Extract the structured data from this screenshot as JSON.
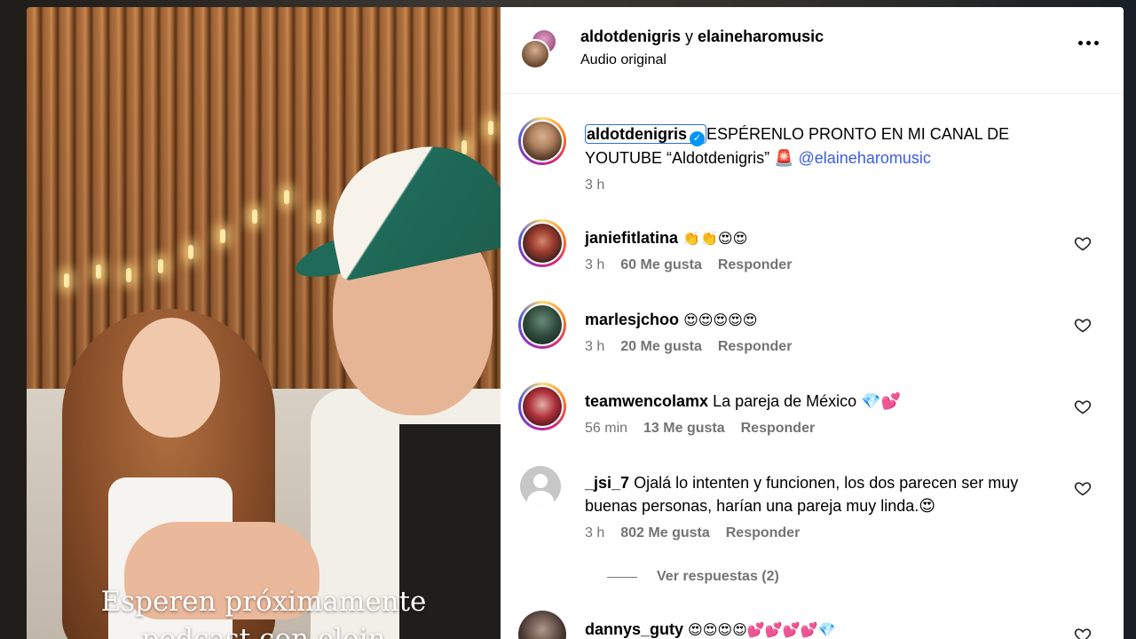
{
  "video": {
    "caption_line1": "Esperen próximamente",
    "caption_line2": "podcast con elein"
  },
  "header": {
    "user1": "aldotdenigris",
    "joiner": "y",
    "user2": "elaineharomusic",
    "subtitle": "Audio original"
  },
  "post": {
    "username": "aldotdenigris",
    "verified_glyph": "✓",
    "text": "ESPÉRENLO PRONTO EN MI CANAL DE YOUTUBE “Aldotdenigris” 🚨",
    "mention": "@elaineharomusic",
    "time": "3 h"
  },
  "comments": [
    {
      "username": "janiefitlatina",
      "text": "👏👏😍😍",
      "time": "3 h",
      "likes": "60 Me gusta",
      "reply": "Responder"
    },
    {
      "username": "marlesjchoo",
      "text": "😍😍😍😍😍",
      "time": "3 h",
      "likes": "20 Me gusta",
      "reply": "Responder"
    },
    {
      "username": "teamwencolamx",
      "text": "La pareja de México 💎💕",
      "time": "56 min",
      "likes": "13 Me gusta",
      "reply": "Responder"
    },
    {
      "username": "_jsi_7",
      "text": "Ojalá lo intenten y funcionen, los dos parecen ser muy buenas personas, harían una pareja muy linda.😍",
      "time": "3 h",
      "likes": "802 Me gusta",
      "reply": "Responder",
      "view_replies": "Ver respuestas (2)"
    },
    {
      "username": "dannys_guty",
      "text": "😍😍😍😍💕💕💕💕💎"
    }
  ],
  "colors": {
    "accent_blue": "#0095f6",
    "mention_blue": "#3b5ce0",
    "meta_gray": "#737373"
  }
}
